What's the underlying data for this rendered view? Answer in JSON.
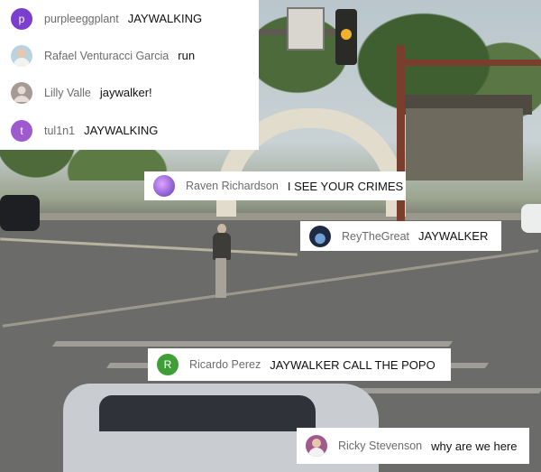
{
  "colors": {
    "avatar_purple": "#7b3fd0",
    "avatar_green": "#3f9e35",
    "avatar_gray": "#a79a95",
    "avatar_galaxy": "#8e6ee0",
    "avatar_dark": "#1f2a40",
    "avatar_mauve": "#a05a8c"
  },
  "pinned_chat": [
    {
      "initial": "p",
      "avatar": "letter-avatar",
      "author": "purpleeggplant",
      "message": "JAYWALKING"
    },
    {
      "initial": "",
      "avatar": "photo-avatar",
      "author": "Rafael Venturacci Garcia",
      "message": "run"
    },
    {
      "initial": "",
      "avatar": "default-avatar",
      "author": "Lilly Valle",
      "message": "jaywalker!"
    },
    {
      "initial": "t",
      "avatar": "letter-avatar",
      "author": "tul1n1",
      "message": "JAYWALKING"
    }
  ],
  "floating_chat": [
    {
      "initial": "",
      "avatar": "galaxy-avatar",
      "author": "Raven Richardson",
      "message": "I SEE YOUR CRIMES"
    },
    {
      "initial": "",
      "avatar": "planet-avatar",
      "author": "ReyTheGreat",
      "message": "JAYWALKER"
    },
    {
      "initial": "R",
      "avatar": "letter-avatar",
      "author": "Ricardo Perez",
      "message": "JAYWALKER CALL THE POPO"
    },
    {
      "initial": "",
      "avatar": "photo-avatar",
      "author": "Ricky Stevenson",
      "message": "why are we here"
    }
  ]
}
